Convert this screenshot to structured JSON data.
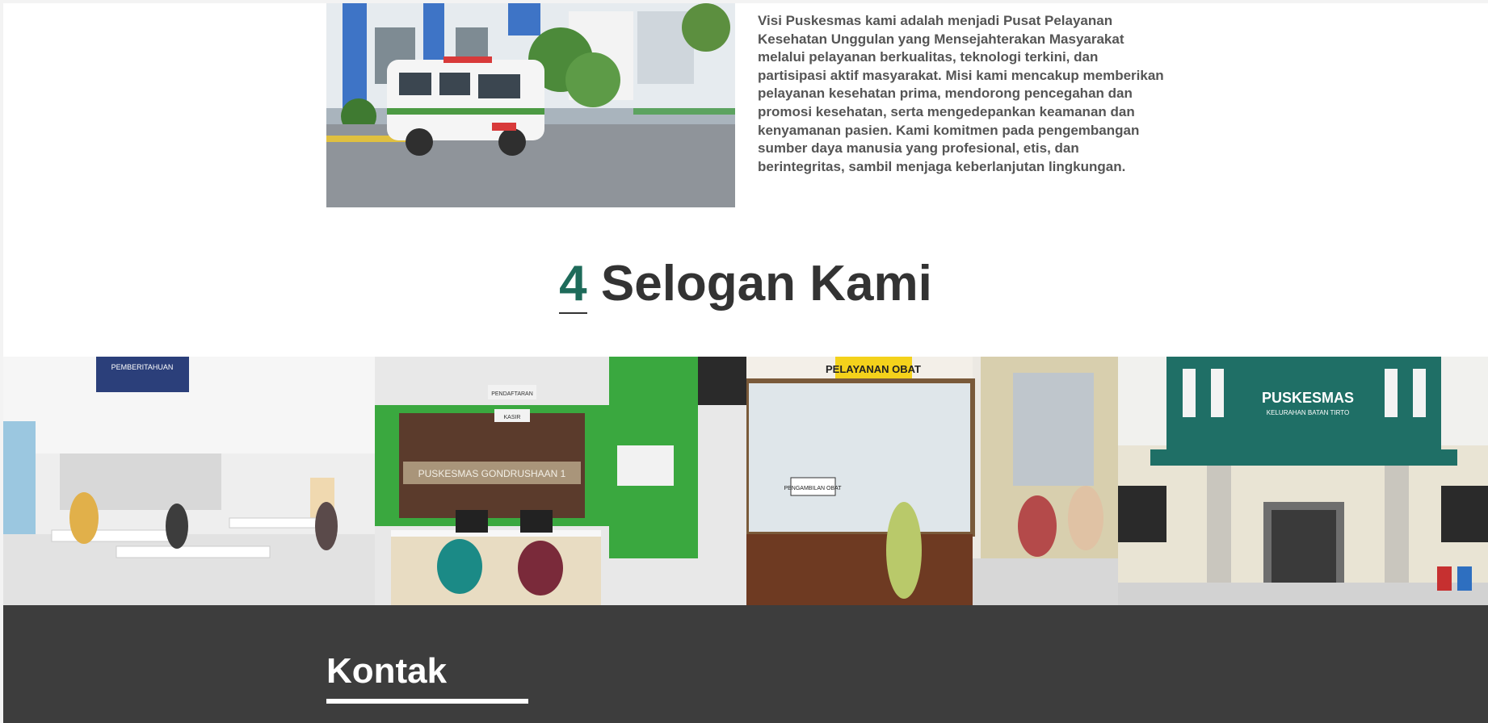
{
  "visi": {
    "photo_name": "ambulance-photo",
    "text": "Visi Puskesmas kami adalah menjadi Pusat Pelayanan Kesehatan Unggulan yang Mensejahterakan Masyarakat melalui pelayanan berkualitas, teknologi terkini, dan partisipasi aktif masyarakat. Misi kami mencakup memberikan pelayanan kesehatan prima, mendorong pencegahan dan promosi kesehatan, serta mengedepankan keamanan dan kenyamanan pasien. Kami komitmen pada pengembangan sumber daya manusia yang profesional, etis, dan berintegritas, sambil menjaga keberlanjutan lingkungan."
  },
  "slogan": {
    "number": "4",
    "title": "Selogan Kami"
  },
  "gallery": {
    "tiles": [
      {
        "name": "waiting-room",
        "sign": "PEMBERITAHUAN"
      },
      {
        "name": "registration-desk",
        "sign_top": "PENDAFTARAN",
        "sign_mid": "KASIR",
        "wall_text": "PUSKESMAS GONDRUSHAAN 1"
      },
      {
        "name": "pharmacy-counter",
        "sign": "PELAYANAN OBAT",
        "label": "PENGAMBILAN OBAT"
      },
      {
        "name": "building-front",
        "sign": "PUSKESMAS",
        "sub": "KELURAHAN BATAN TIRTO"
      }
    ]
  },
  "footer": {
    "title": "Kontak"
  },
  "colors": {
    "accent": "#1e6b5a",
    "heading": "#333333",
    "body_text": "#555555",
    "footer_bg": "#3d3d3d"
  }
}
